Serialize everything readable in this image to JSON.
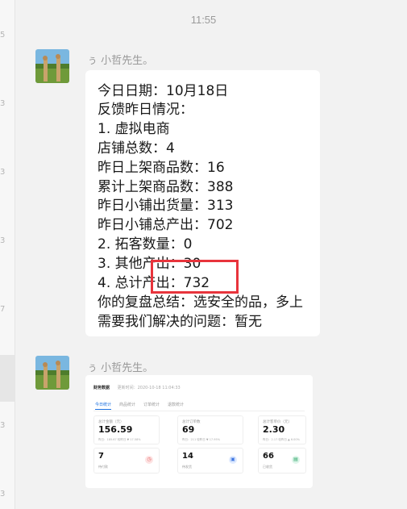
{
  "time": "11:55",
  "messages": [
    {
      "sender": "ぅ 小哲先生。",
      "lines": [
        "今日日期：10月18日",
        "反馈昨日情况：",
        "1. 虚拟电商",
        "店铺总数：4",
        "昨日上架商品数：16",
        "累计上架商品数：388",
        "昨日小铺出货量：313",
        "昨日小铺总产出：702",
        "2. 拓客数量：0",
        "3. 其他产出：30",
        "4. 总计产出：732",
        "你的复盘总结：选安全的品，多上",
        "需要我们解决的问题：暂无"
      ]
    },
    {
      "sender": "ぅ 小哲先生。",
      "card": {
        "title": "财务数据",
        "subtitle": "更新时间：2020-10-18 11:04:33",
        "tabs": [
          "今日统计",
          "商品统计",
          "订单统计",
          "退款统计"
        ],
        "stats": [
          {
            "label": "总计金额（元）",
            "value": "156.59",
            "sub": "昨日：185.67  较昨日 ▼ 17.58%"
          },
          {
            "label": "总计订单数",
            "value": "69",
            "sub": "昨日：211  较昨日 ▼ 17.95%"
          },
          {
            "label": "总计客单价（元）",
            "value": "2.30",
            "sub": "昨日：2.17  较昨日 ▲ 6.00%"
          }
        ],
        "small_stats": [
          {
            "value": "7",
            "label": "待付款"
          },
          {
            "value": "14",
            "label": "待发货"
          },
          {
            "value": "66",
            "label": "已收货"
          }
        ]
      }
    }
  ],
  "left_strip_marks": [
    "5",
    "3",
    "3",
    "3",
    "7",
    "3",
    "3"
  ]
}
